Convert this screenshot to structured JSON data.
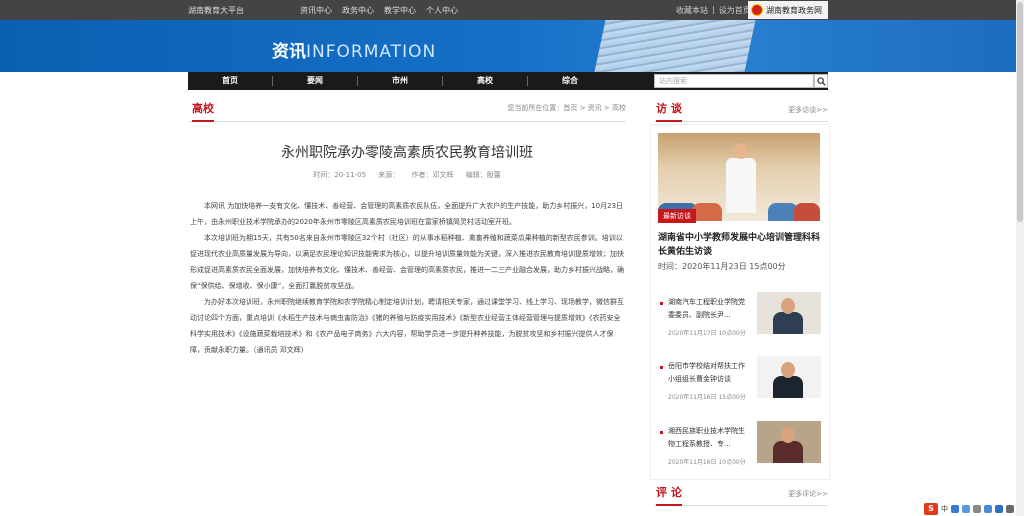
{
  "topbar": {
    "site": "湖南教育大平台",
    "links": [
      "资讯中心",
      "政务中心",
      "教学中心",
      "个人中心"
    ],
    "right_links": [
      "收藏本站",
      "|",
      "设为首页"
    ],
    "gov_label": "湖南教育政务网"
  },
  "banner": {
    "title_cn": "资讯",
    "title_en": "INFORMATION"
  },
  "nav": {
    "items": [
      "首页",
      "要闻",
      "市州",
      "高校",
      "综合"
    ],
    "search_placeholder": "站内搜索"
  },
  "section": {
    "tag": "高校",
    "breadcrumb": "您当前所在位置：首页 > 资讯 > 高校"
  },
  "article": {
    "title": "永州职院承办零陵高素质农民教育培训班",
    "time": "时间：20-11-05",
    "source": "来源：",
    "author": "作者：邓文辉",
    "editor": "编辑：殷蕾",
    "paragraphs": [
      "本网讯 为加快培养一支有文化、懂技术、善经营、会管理的高素质农民队伍，全面提升广大农户的生产技能，助力乡村振兴，10月23日上午，由永州职业技术学院承办的2020年永州市零陵区高素质农民培训班在富家桥镇简灵村活动室开班。",
      "本次培训班为期15天，共有50名来自永州市零陵区32个村（社区）的从事水稻种植、禽畜养殖和蔬菜瓜果种植的新型农民参训。培训以促进现代农业高质量发展为导向，以满足农民理论知识技能需求为核心，以提升培训质量效能为关键，深入推进农民教育培训提质增效；加快形成促进高素质农民全面发展，加快培养有文化、懂技术、善经营、会管理的高素质农民，推进一二三产业融合发展，助力乡村振兴战略，确保“保供给、保增收、保小康”，全面打赢脱贫攻坚战。",
      "为办好本次培训班，永州职院继续教育学院和农学院精心制定培训计划，聘请相关专家，通过课堂学习、线上学习、现场教学，微信群互动讨论四个方面，重点培训《水稻生产技术与病虫害防治》《猪的养殖与防疫实用技术》《新型农业经营主体经营管理与提质增效》《农药安全科学实用技术》《设施蔬菜栽培技术》和《农产品电子商务》六大内容，帮助学员进一步提升种养技能，为脱贫攻坚和乡村振兴提供人才保障，贡献永职力量。（通讯员 邓文辉）"
    ]
  },
  "interview": {
    "heading": "访 谈",
    "more": "更多访谈>>",
    "featured": {
      "tag": "最新访谈",
      "title": "湖南省中小学教师发展中心培训管理科科长黄佑生访谈",
      "time": "时间：2020年11月23日 15点00分"
    },
    "items": [
      {
        "title": "湖南汽车工程职业学院党委委员、副院长尹...",
        "time": "2020年11月17日 10点00分"
      },
      {
        "title": "岳阳市学校结对帮扶工作小组组长曹金钟访谈",
        "time": "2020年11月16日 15点00分"
      },
      {
        "title": "湘西民族职业技术学院生物工程系教授、专...",
        "time": "2020年11月16日 10点00分"
      }
    ]
  },
  "comment": {
    "heading": "评 论",
    "more": "更多评论>>"
  },
  "tray": {
    "ime": "S",
    "lang": "中"
  },
  "colors": {
    "accent": "#c8161d",
    "banner": "#1670c8",
    "nav": "#1a1a1a"
  }
}
